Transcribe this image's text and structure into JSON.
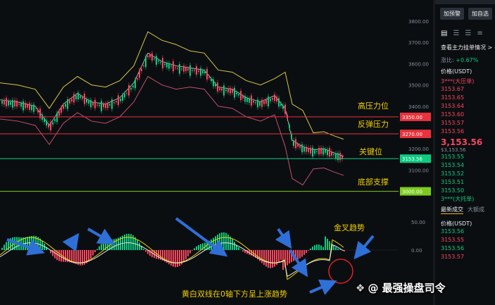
{
  "chart": {
    "y_axis_ticks": [
      "3800.00",
      "3700.00",
      "3600.00",
      "3500.00",
      "3400.00",
      "3200.00",
      "3100.00"
    ],
    "y_tick_values": [
      3800,
      3700,
      3600,
      3500,
      3400,
      3200,
      3100
    ],
    "level_tags": [
      {
        "value": 3350,
        "label": "3350.00",
        "color": "#e8323c"
      },
      {
        "value": 3270,
        "label": "3270.00",
        "color": "#e8323c"
      },
      {
        "value": 3153.56,
        "label": "3153.56",
        "color": "#0ecb81"
      },
      {
        "value": 3000,
        "label": "3000.00",
        "color": "#7ecb20"
      }
    ],
    "annotations": {
      "high_pressure": "高压力位",
      "rebound_pressure": "反弹压力",
      "key_level": "关键位",
      "bottom_support": "底部支撑",
      "golden_cross": "金叉趋势",
      "yellow_white": "黄白双线在0轴下方呈上涨趋势"
    },
    "macd_ticks": [
      "50.00",
      "0.00"
    ],
    "colors": {
      "annotation": "#f0d000",
      "up": "#0ecb81",
      "down": "#f6465d",
      "boll": "#d8c840",
      "mid": "#d0d0d0",
      "arrow": "#2f6fd8",
      "circle": "#e02020"
    }
  },
  "panel": {
    "buttons": [
      "加预警",
      "加自选"
    ],
    "icons": [
      "orderbook-icon",
      "orderbook-bids-icon",
      "orderbook-asks-icon",
      "list-icon"
    ],
    "link": "查看主力挂单情况 >",
    "change_label": "涨比:",
    "change_value": "+0.67%",
    "price_header": "价格(USDT)",
    "asks_label": "3***(大压单)",
    "asks": [
      "3153.67",
      "3153.65",
      "3153.64",
      "3153.60",
      "3153.57",
      "3153.56"
    ],
    "last_price": "3,153.56",
    "last_sub": "$3,153.56",
    "bids": [
      "3153.55",
      "3153.54",
      "3153.52",
      "3153.51",
      "3153.50"
    ],
    "bids_label": "3***(大托单)",
    "tabs": [
      "最新成交",
      "大额成"
    ],
    "trades_header": "价格(USDT)",
    "trades": [
      {
        "price": "3153.56",
        "side": "up"
      },
      {
        "price": "3153.55",
        "side": "down"
      },
      {
        "price": "3153.56",
        "side": "up"
      },
      {
        "price": "3153.57",
        "side": "down"
      }
    ]
  },
  "watermark": "@ 最强操盘司令"
}
